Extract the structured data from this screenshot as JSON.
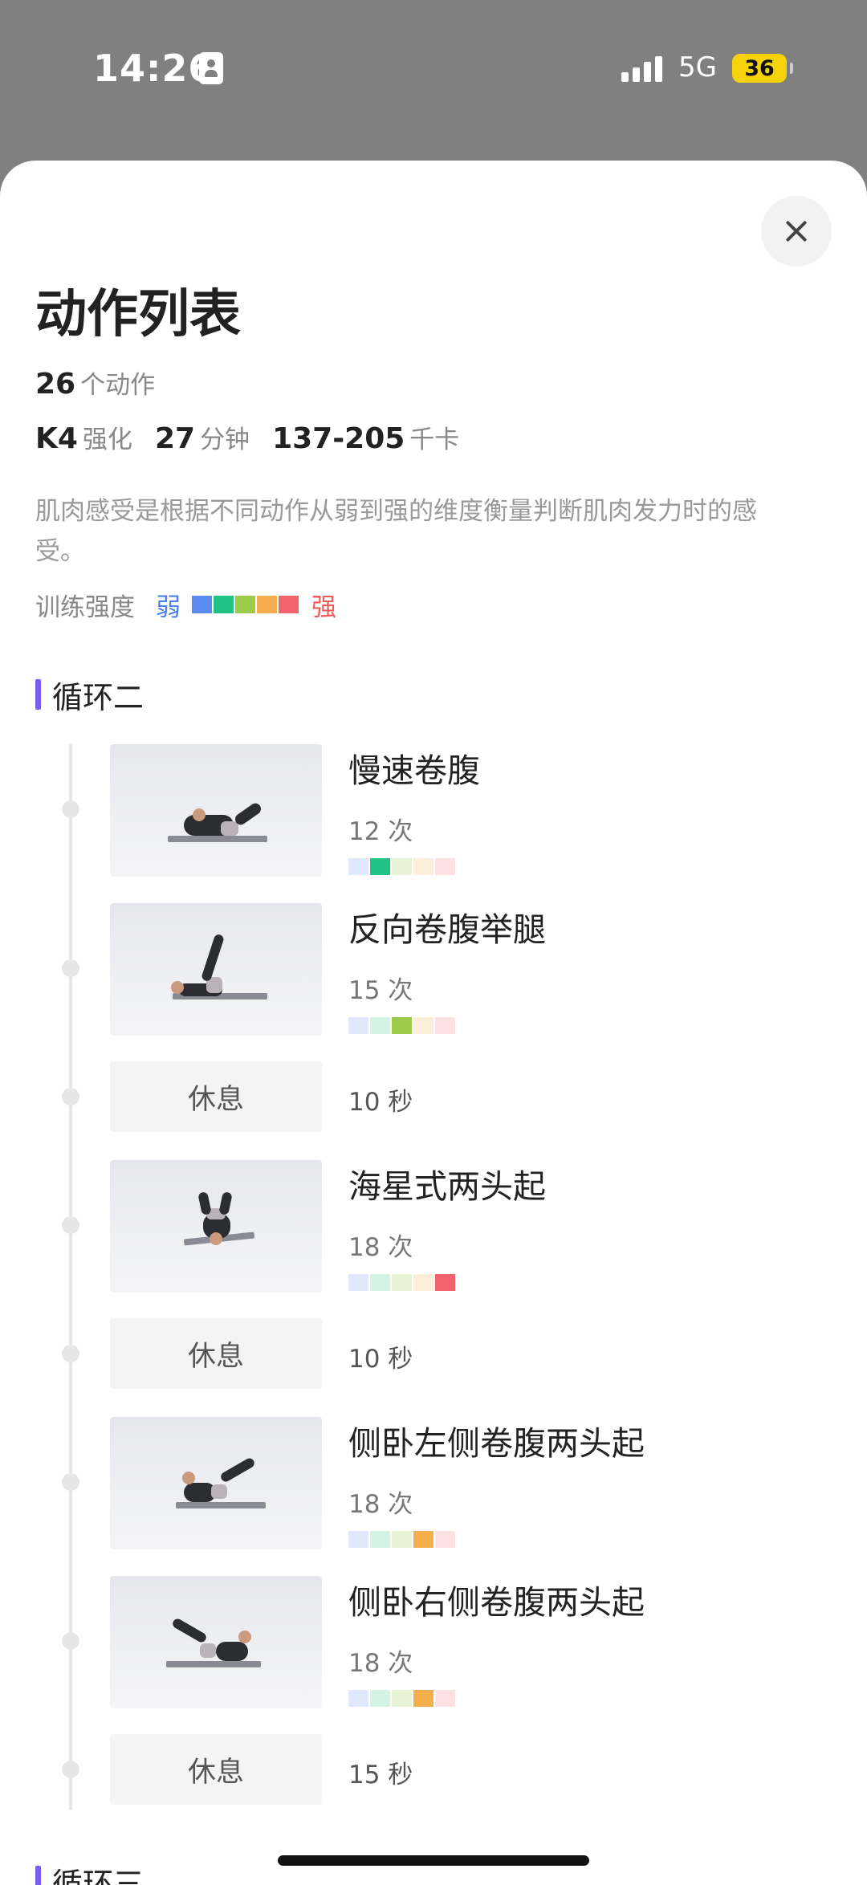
{
  "status_bar": {
    "time": "14:26",
    "network": "5G",
    "battery": "36"
  },
  "sheet": {
    "title": "动作列表",
    "action_count": "26",
    "action_count_unit": "个动作",
    "level": "K4",
    "level_label": "强化",
    "duration": "27",
    "duration_unit": "分钟",
    "calories": "137-205",
    "calories_unit": "千卡",
    "description": "肌肉感受是根据不同动作从弱到强的维度衡量判断肌肉发力时的感受。",
    "intensity_legend": {
      "label": "训练强度",
      "weak": "弱",
      "strong": "强",
      "colors": [
        "#5b8cf2",
        "#22c285",
        "#9ccc4a",
        "#f5ad4e",
        "#f2636b"
      ],
      "faded_colors": [
        "#dfe8fd",
        "#d3f3e5",
        "#e8f3d6",
        "#fdeeda",
        "#fde0e2"
      ]
    }
  },
  "sections": [
    {
      "title": "循环二",
      "items": [
        {
          "type": "exercise",
          "name": "慢速卷腹",
          "reps": "12 次",
          "intensity_level": 2
        },
        {
          "type": "exercise",
          "name": "反向卷腹举腿",
          "reps": "15 次",
          "intensity_level": 3
        },
        {
          "type": "rest",
          "label": "休息",
          "duration": "10 秒"
        },
        {
          "type": "exercise",
          "name": "海星式两头起",
          "reps": "18 次",
          "intensity_level": 5
        },
        {
          "type": "rest",
          "label": "休息",
          "duration": "10 秒"
        },
        {
          "type": "exercise",
          "name": "侧卧左侧卷腹两头起",
          "reps": "18 次",
          "intensity_level": 4
        },
        {
          "type": "exercise",
          "name": "侧卧右侧卷腹两头起",
          "reps": "18 次",
          "intensity_level": 4
        },
        {
          "type": "rest",
          "label": "休息",
          "duration": "15 秒"
        }
      ]
    },
    {
      "title": "循环三"
    }
  ],
  "icons": {
    "close": "close-icon",
    "thumbnail": "exercise-thumbnail"
  }
}
